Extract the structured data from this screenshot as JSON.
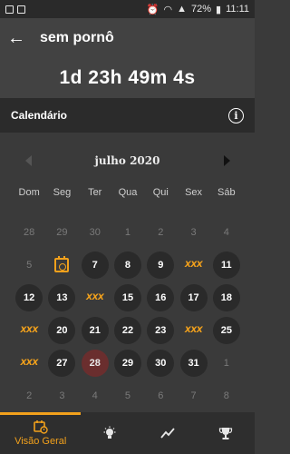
{
  "statusbar": {
    "left_icons": [
      "gallery-icon",
      "notification-icon"
    ],
    "battery": "72%",
    "time": "11:11"
  },
  "appbar": {
    "title": "sem pornô"
  },
  "counter": {
    "value": "1d 23h 49m 4s"
  },
  "section": {
    "title": "Calendário"
  },
  "calendar": {
    "month_label": "julho 2020",
    "weekdays": [
      "Dom",
      "Seg",
      "Ter",
      "Qua",
      "Qui",
      "Sex",
      "Sáb"
    ],
    "relapse_mark": "XXX",
    "days": [
      {
        "label": "28",
        "kind": "other"
      },
      {
        "label": "29",
        "kind": "other"
      },
      {
        "label": "30",
        "kind": "other"
      },
      {
        "label": "1",
        "kind": "other"
      },
      {
        "label": "2",
        "kind": "other"
      },
      {
        "label": "3",
        "kind": "other"
      },
      {
        "label": "4",
        "kind": "other"
      },
      {
        "label": "5",
        "kind": "other"
      },
      {
        "label": "",
        "kind": "start"
      },
      {
        "label": "7",
        "kind": "active"
      },
      {
        "label": "8",
        "kind": "active"
      },
      {
        "label": "9",
        "kind": "active"
      },
      {
        "label": "",
        "kind": "relapse"
      },
      {
        "label": "11",
        "kind": "active"
      },
      {
        "label": "12",
        "kind": "active"
      },
      {
        "label": "13",
        "kind": "active"
      },
      {
        "label": "",
        "kind": "relapse"
      },
      {
        "label": "15",
        "kind": "active"
      },
      {
        "label": "16",
        "kind": "active"
      },
      {
        "label": "17",
        "kind": "active"
      },
      {
        "label": "18",
        "kind": "active"
      },
      {
        "label": "",
        "kind": "relapse"
      },
      {
        "label": "20",
        "kind": "active"
      },
      {
        "label": "21",
        "kind": "active"
      },
      {
        "label": "22",
        "kind": "active"
      },
      {
        "label": "23",
        "kind": "active"
      },
      {
        "label": "",
        "kind": "relapse"
      },
      {
        "label": "25",
        "kind": "active"
      },
      {
        "label": "",
        "kind": "relapse"
      },
      {
        "label": "27",
        "kind": "active"
      },
      {
        "label": "28",
        "kind": "today"
      },
      {
        "label": "29",
        "kind": "active"
      },
      {
        "label": "30",
        "kind": "active"
      },
      {
        "label": "31",
        "kind": "active"
      },
      {
        "label": "1",
        "kind": "other"
      },
      {
        "label": "2",
        "kind": "other"
      },
      {
        "label": "3",
        "kind": "other"
      },
      {
        "label": "4",
        "kind": "other"
      },
      {
        "label": "5",
        "kind": "other"
      },
      {
        "label": "6",
        "kind": "other"
      },
      {
        "label": "7",
        "kind": "other"
      },
      {
        "label": "8",
        "kind": "other"
      }
    ]
  },
  "bottomnav": {
    "tabs": [
      {
        "label": "Visão Geral",
        "icon": "calendar-clock-icon",
        "selected": true
      },
      {
        "label": "",
        "icon": "lightbulb-icon",
        "selected": false
      },
      {
        "label": "",
        "icon": "trending-icon",
        "selected": false
      },
      {
        "label": "",
        "icon": "trophy-icon",
        "selected": false
      }
    ]
  },
  "colors": {
    "accent": "#f2a11c",
    "today_bg": "#6a2e2e",
    "day_bg": "#2a2a2a"
  }
}
